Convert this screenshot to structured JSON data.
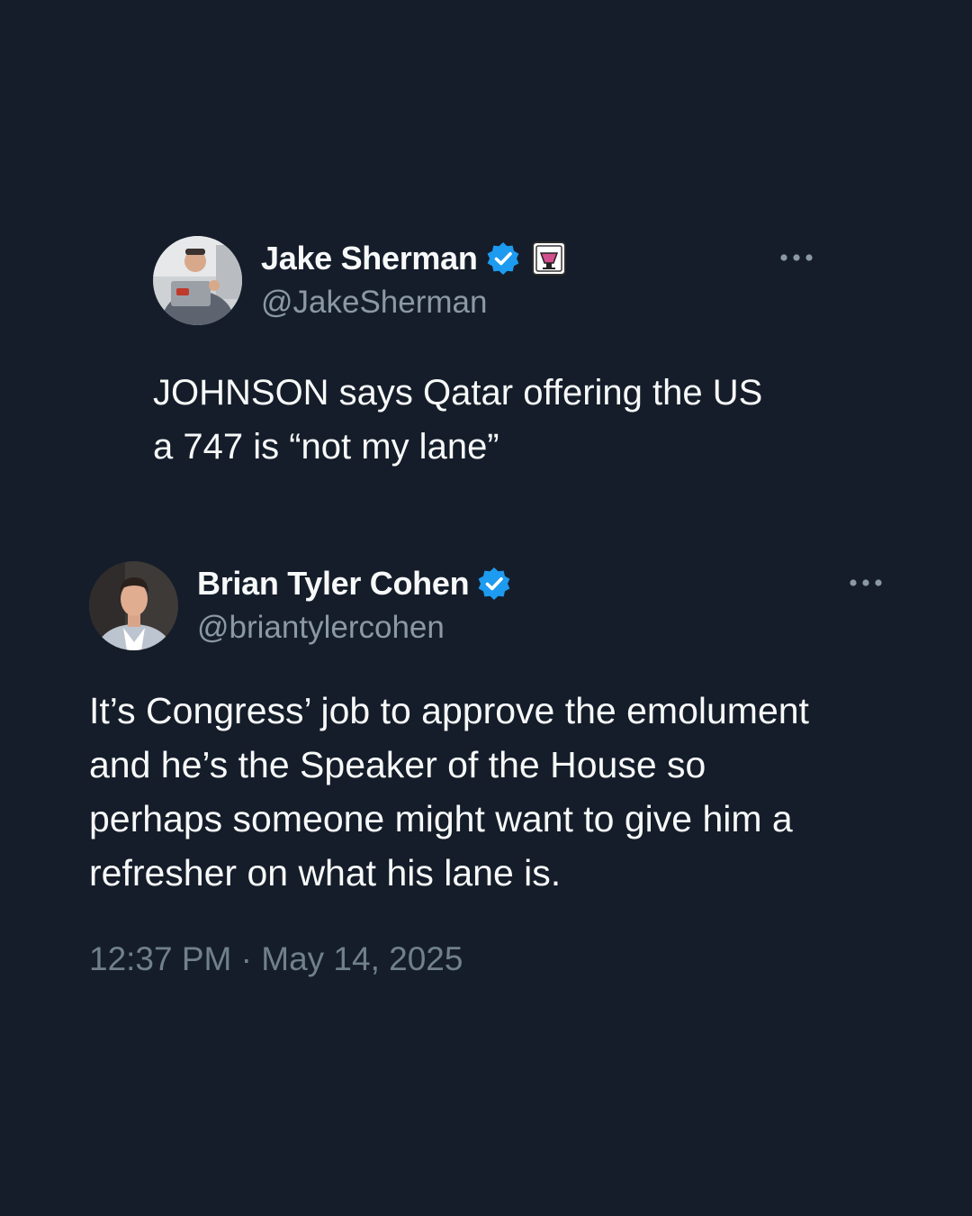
{
  "quoted_tweet": {
    "author": {
      "display_name": "Jake Sherman",
      "handle": "@JakeSherman",
      "verified": true,
      "affiliate_badge": "punchbowl-news-icon"
    },
    "text": "JOHNSON says Qatar offering the US\na 747 is “not my lane”",
    "more_icon": "more-horizontal-icon"
  },
  "main_tweet": {
    "author": {
      "display_name": "Brian Tyler Cohen",
      "handle": "@briantylercohen",
      "verified": true
    },
    "text": "It’s Congress’ job to approve the emolument\nand he’s the Speaker of the House so\nperhaps someone might want to give him a\nrefresher on what his lane is.",
    "more_icon": "more-horizontal-icon",
    "timestamp": "12:37 PM · May 14, 2025"
  },
  "colors": {
    "background": "#151d2a",
    "text_primary": "#f7f9f9",
    "text_secondary": "#8b98a5",
    "verified_blue": "#1d9bf0"
  }
}
